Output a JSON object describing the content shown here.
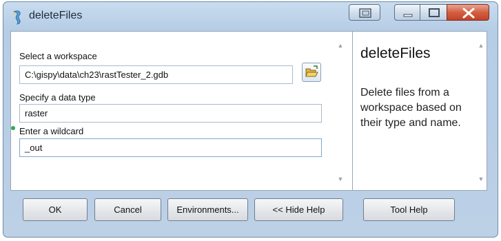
{
  "window": {
    "title": "deleteFiles",
    "buttons": [
      "restore-tool",
      "minimize",
      "maximize",
      "close"
    ]
  },
  "form": {
    "workspace_label": "Select a workspace",
    "workspace_value": "C:\\gispy\\data\\ch23\\rastTester_2.gdb",
    "datatype_label": "Specify a data type",
    "datatype_value": "raster",
    "wildcard_label": "Enter a wildcard",
    "wildcard_value": "_out",
    "required_dot_color": "#2fa84f"
  },
  "help": {
    "title": "deleteFiles",
    "body": "Delete files from a workspace based on their type and name."
  },
  "buttons": {
    "ok": "OK",
    "cancel": "Cancel",
    "environments": "Environments...",
    "hide_help": "<< Hide Help",
    "tool_help": "Tool Help"
  },
  "icons": {
    "app": "python-script-icon",
    "browse": "folder-open-icon"
  }
}
